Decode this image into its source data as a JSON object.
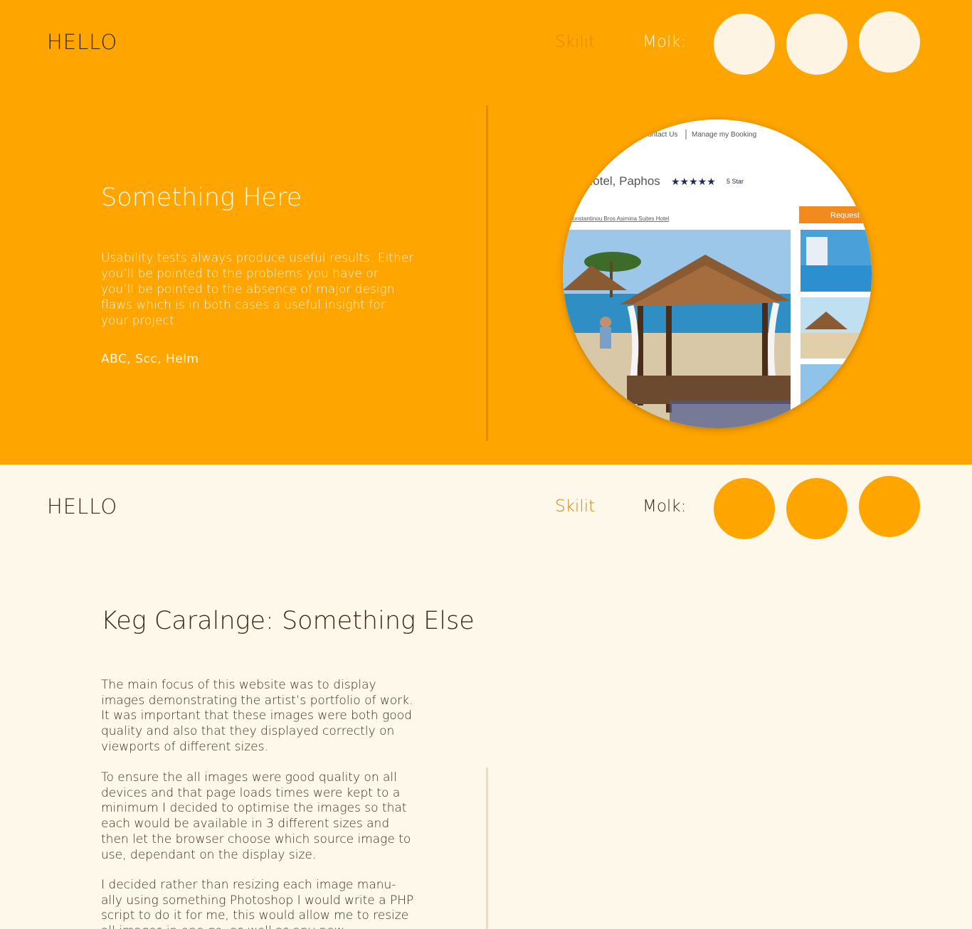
{
  "top_section": {
    "brand": "HELLO",
    "nav_link": "Skilit",
    "nav_label": "Molk:",
    "title": "Something Here",
    "paragraph": "Usability tests always produce useful results. Either you’ll be pointed to the problems you have or you’ll be pointed to the absence of major design flaws which is in both cases a useful insight for your project.",
    "credits": "ABC, Scc, Helm",
    "screenshot": {
      "nav_contact": "Contact Us",
      "nav_manage": "Manage my Booking",
      "hotel_title": "Hotel, Paphos",
      "stars_label": "5 Star",
      "hotel_link": "Constantinou Bros Asimina Suites Hotel",
      "request_button": "Request"
    }
  },
  "bottom_section": {
    "brand": "HELLO",
    "nav_link": "Skilit",
    "nav_label": "Molk:",
    "title": "Keg Caralnge: Something Else",
    "paragraphs": [
      "The main focus of this website was to display images demonstrating the artist’s portfolio of work. It was important that these images were both good quality and also that they displayed correctly on viewports of different sizes.",
      "To ensure the all images were good quality on all devices and that page loads times were kept to a minimum I decided to optimise the images so that each would be available in 3 different sizes and then let the browser choose which source image to use, dependant on the display size.",
      "I decided rather than resizing each image manu-ally using something Photoshop I would write a PHP script to do it for me, this would allow me to resize all images in one go, as well as any new"
    ]
  },
  "colors": {
    "orange": "#ffa500",
    "cream": "#fdf8ea",
    "dark_text": "#3b2a1a"
  }
}
